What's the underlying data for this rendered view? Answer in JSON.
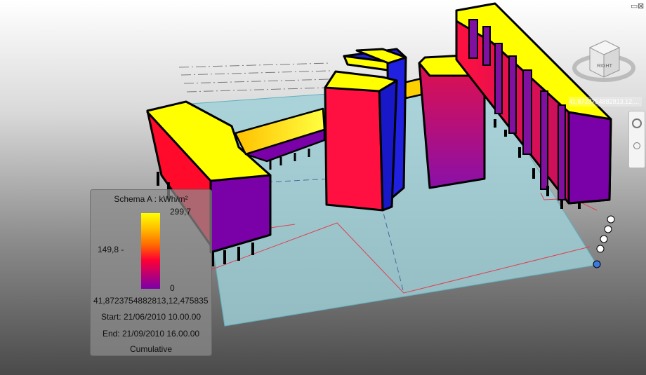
{
  "legend": {
    "title": "Schema A : kWh/m²",
    "max_label": "299,7",
    "mid_label": "149,8 -",
    "min_label": "0",
    "location": "41,8723754882813,12,475835",
    "start": "Start: 21/06/2010 10.00.00",
    "end": "End: 21/09/2010 16.00.00",
    "mode": "Cumulative"
  },
  "viewcube": {
    "face_label": "RIGHT"
  },
  "coordinates_readout": "41,8723754882813,12,...",
  "window_controls": {
    "restore": "▭",
    "close": "⊠"
  },
  "colors": {
    "max": "#ffff00",
    "mid": "#ff0033",
    "min": "#7a00a8",
    "site_plane": "#9fd0d8"
  }
}
